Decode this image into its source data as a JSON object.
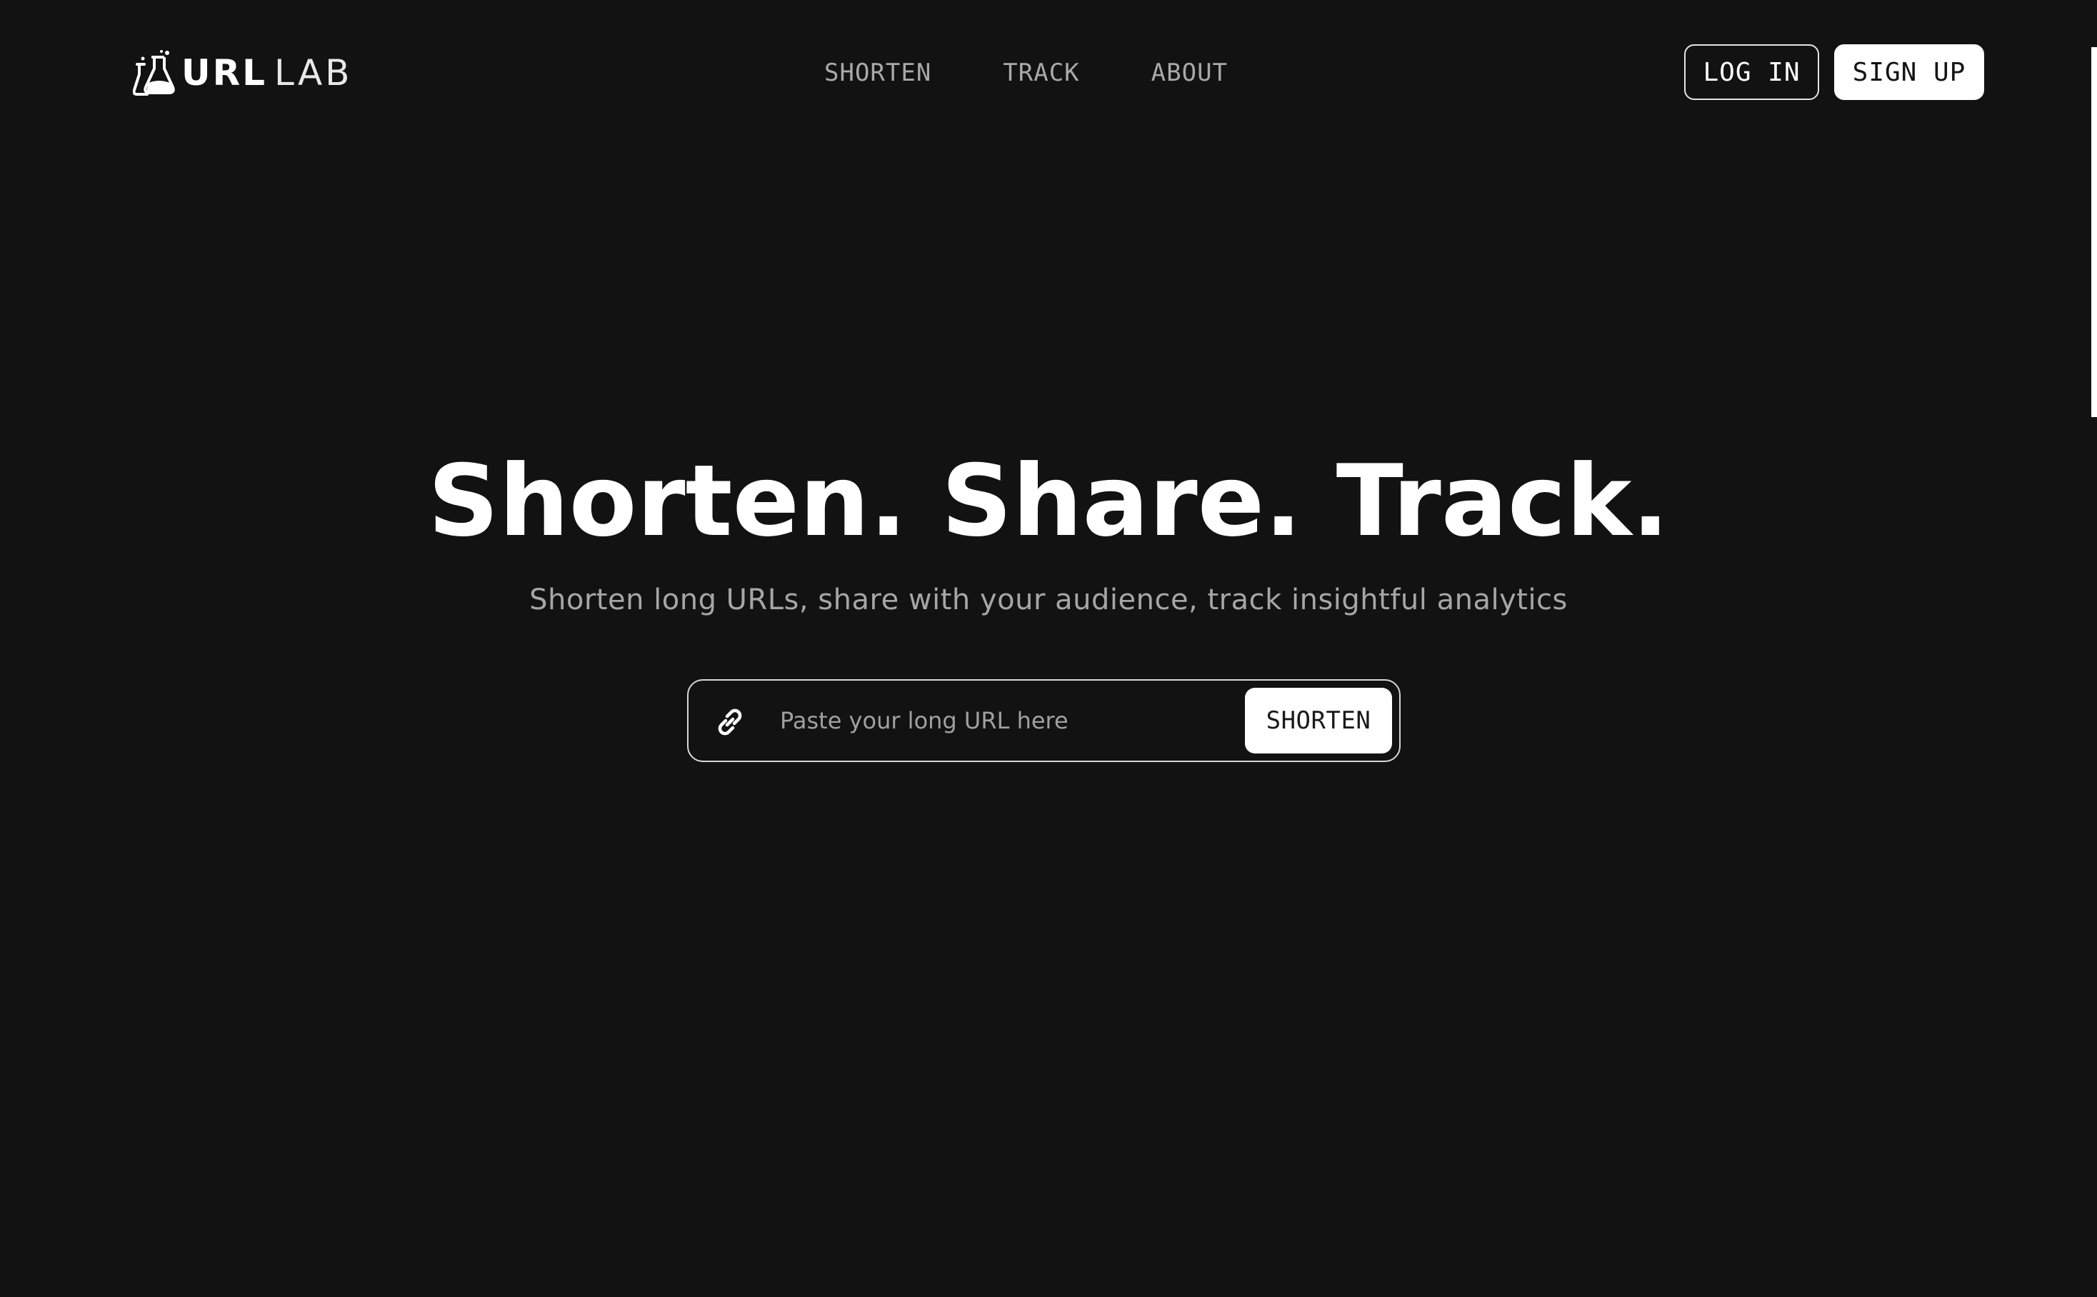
{
  "header": {
    "logo": {
      "bold": "URL",
      "light": "LAB",
      "icon": "flask-icon"
    },
    "nav": [
      {
        "label": "SHORTEN"
      },
      {
        "label": "TRACK"
      },
      {
        "label": "ABOUT"
      }
    ],
    "login_label": "LOG IN",
    "signup_label": "SIGN UP"
  },
  "hero": {
    "title": "Shorten. Share. Track.",
    "subtitle": "Shorten long URLs, share with your audience, track insightful analytics"
  },
  "form": {
    "icon": "link-icon",
    "placeholder": "Paste your long URL here",
    "value": "",
    "submit_label": "SHORTEN"
  },
  "colors": {
    "background": "#121212",
    "foreground": "#ffffff",
    "muted": "#a6a6a6",
    "border": "#d8d8d8"
  }
}
